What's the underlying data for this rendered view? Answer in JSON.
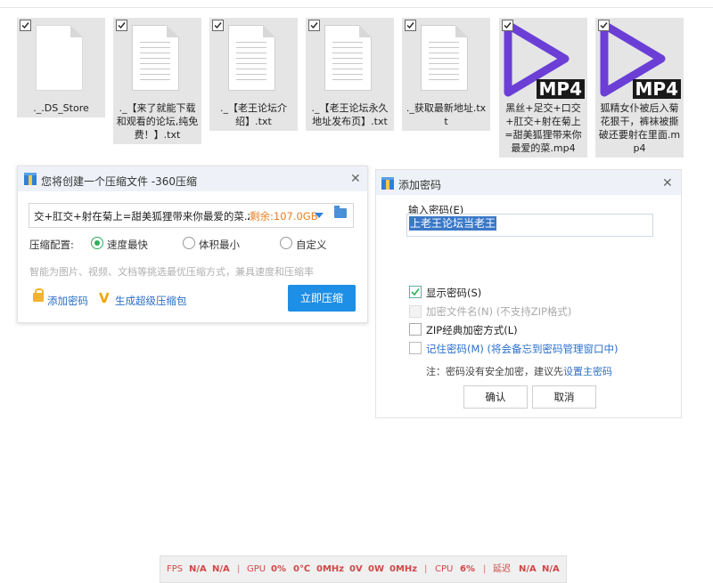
{
  "files": [
    {
      "name": "._.DS_Store",
      "type": "blank"
    },
    {
      "name": "._【来了就能下载和观看的论坛,纯免费！】.txt",
      "type": "txt"
    },
    {
      "name": "._【老王论坛介绍】.txt",
      "type": "txt"
    },
    {
      "name": "._【老王论坛永久地址发布页】.txt",
      "type": "txt"
    },
    {
      "name": "._获取最新地址.txt",
      "type": "txt"
    },
    {
      "name": "黑丝+足交+口交+肛交+射在菊上=甜美狐狸带来你最爱的菜.mp4",
      "type": "mp4",
      "badge": "MP4"
    },
    {
      "name": "狐精女仆被后入菊花狠干，裤袜被撕破还要射在里面.mp4",
      "type": "mp4",
      "badge": "MP4"
    }
  ],
  "compress_dialog": {
    "title": "您将创建一个压缩文件 -360压缩",
    "filename": "交+肛交+射在菊上=甜美狐狸带来你最爱的菜.zip",
    "remaining": "剩余:107.0GB",
    "config_label": "压缩配置:",
    "options": [
      "速度最快",
      "体积最小",
      "自定义"
    ],
    "selected_option": "速度最快",
    "hint": "智能为图片、视频、文档等挑选最优压缩方式，兼具速度和压缩率",
    "add_password": "添加密码",
    "super_package": "生成超级压缩包",
    "compress_now": "立即压缩"
  },
  "password_dialog": {
    "title": "添加密码",
    "input_label": "输入密码(E)",
    "password_value": "上老王论坛当老王",
    "show_password": "显示密码(S)",
    "show_password_checked": true,
    "encrypt_filenames": "加密文件名(N) (不支持ZIP格式)",
    "zip_classic": "ZIP经典加密方式(L)",
    "remember_password": "记住密码(M) (将会备忘到密码管理窗口中)",
    "note_prefix": "注：密码没有安全加密，建议先",
    "note_link": "设置主密码",
    "ok": "确认",
    "cancel": "取消"
  },
  "status_bar": {
    "fps_label": "FPS",
    "fps_v1": "N/A",
    "fps_v2": "N/A",
    "gpu_label": "GPU",
    "gpu_pct": "0%",
    "gpu_temp": "0℃",
    "gpu_mhz": "0MHz",
    "gpu_v": "0V",
    "gpu_w": "0W",
    "gpu_mhz2": "0MHz",
    "cpu_label": "CPU",
    "cpu_pct": "6%",
    "lat_label": "延迟",
    "lat_v1": "N/A",
    "lat_v2": "N/A"
  },
  "colors": {
    "accent": "#1e8fe6",
    "mp4_purple": "#6b3fd6",
    "remaining": "#e67e22"
  }
}
